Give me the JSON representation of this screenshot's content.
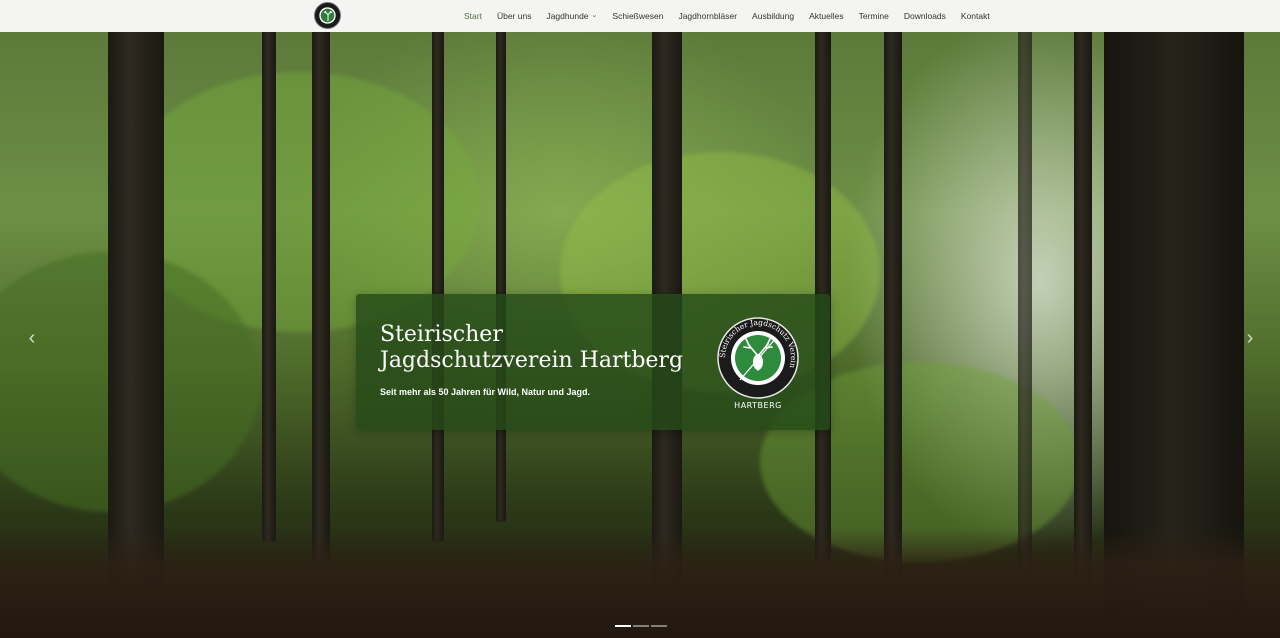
{
  "header": {
    "logo_icon": "club-emblem-icon",
    "nav": [
      {
        "label": "Start",
        "active": true,
        "has_dropdown": false
      },
      {
        "label": "Über uns",
        "active": false,
        "has_dropdown": false
      },
      {
        "label": "Jagdhunde",
        "active": false,
        "has_dropdown": true
      },
      {
        "label": "Schießwesen",
        "active": false,
        "has_dropdown": false
      },
      {
        "label": "Jagdhornbläser",
        "active": false,
        "has_dropdown": false
      },
      {
        "label": "Ausbildung",
        "active": false,
        "has_dropdown": false
      },
      {
        "label": "Aktuelles",
        "active": false,
        "has_dropdown": false
      },
      {
        "label": "Termine",
        "active": false,
        "has_dropdown": false
      },
      {
        "label": "Downloads",
        "active": false,
        "has_dropdown": false
      },
      {
        "label": "Kontakt",
        "active": false,
        "has_dropdown": false
      }
    ]
  },
  "hero": {
    "title": "Steirischer Jagdschutzverein Hartberg",
    "subtitle": "Seit mehr als 50 Jahren für Wild, Natur und Jagd.",
    "emblem": {
      "ring_text": "Steirischer Jagdschutz Verein",
      "bottom_text": "HARTBERG"
    },
    "prev_icon": "chevron-left-icon",
    "next_icon": "chevron-right-icon",
    "slides_total": 3,
    "slide_active": 1
  },
  "colors": {
    "accent_green": "#4c7a3c",
    "card_bg": "#264a18",
    "topbar_bg": "#f4f4f2"
  }
}
